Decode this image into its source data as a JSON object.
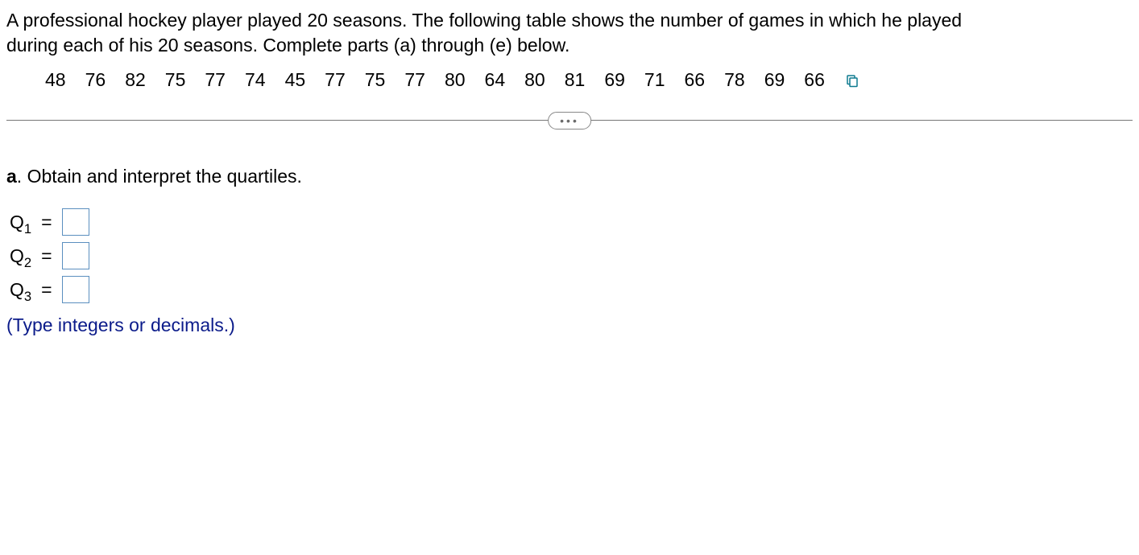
{
  "prompt": {
    "line1": "A professional hockey player played 20 seasons. The following table shows the number of games in which he played",
    "line2": "during each of his 20 seasons. Complete parts (a) through (e) below."
  },
  "data": [
    "48",
    "76",
    "82",
    "75",
    "77",
    "74",
    "45",
    "77",
    "75",
    "77",
    "80",
    "64",
    "80",
    "81",
    "69",
    "71",
    "66",
    "78",
    "69",
    "66"
  ],
  "divider": {
    "more": "• • •"
  },
  "partA": {
    "label_bold": "a",
    "label_rest": ". Obtain and interpret the quartiles."
  },
  "quartiles": {
    "q1_label": "Q",
    "q1_sub": "1",
    "q2_label": "Q",
    "q2_sub": "2",
    "q3_label": "Q",
    "q3_sub": "3",
    "equals": "="
  },
  "hint": "(Type integers or decimals.)",
  "icons": {
    "copy": "copy-icon",
    "more": "more-icon"
  }
}
